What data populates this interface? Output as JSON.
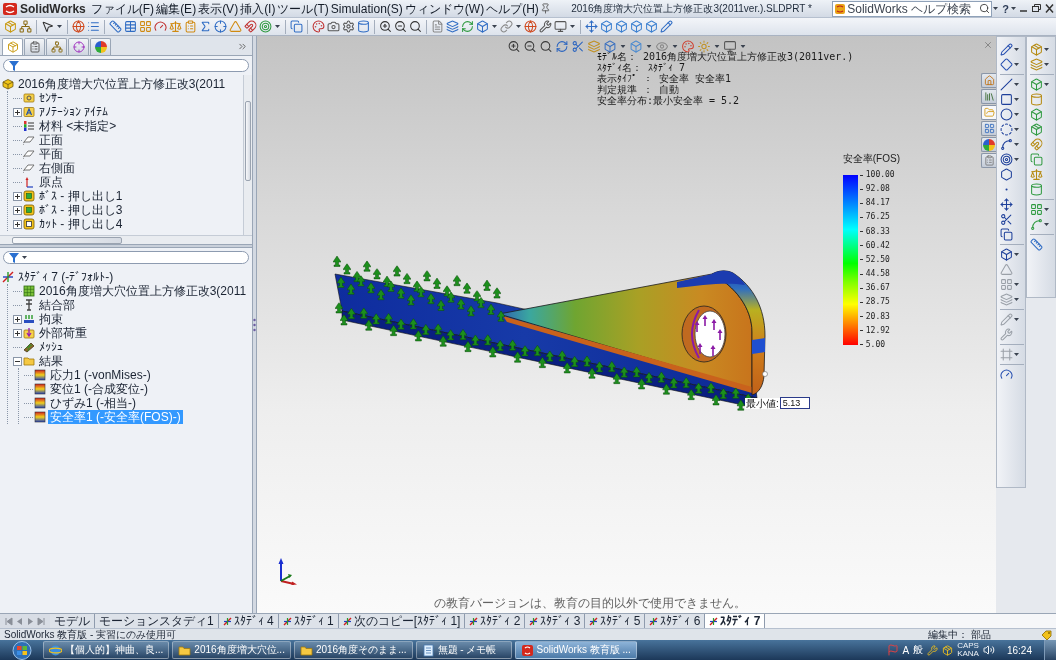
{
  "window": {
    "title": "2016角度増大穴位置上方修正改3(2011ver.).SLDPRT *"
  },
  "app": {
    "logo": "SolidWorks"
  },
  "menu": [
    "ファイル(F)",
    "編集(E)",
    "表示(V)",
    "挿入(I)",
    "ツール(T)",
    "Simulation(S)",
    "ウィンドウ(W)",
    "ヘルプ(H)"
  ],
  "search": {
    "placeholder": "SolidWorks ヘルプ検索"
  },
  "help": "?",
  "panel_tabs": [
    {
      "kind": "features",
      "selected": true
    },
    {
      "kind": "properties",
      "selected": false
    },
    {
      "kind": "configurations",
      "selected": false
    },
    {
      "kind": "dimxpert",
      "selected": false
    },
    {
      "kind": "display",
      "selected": false
    }
  ],
  "feature_tree": {
    "items": [
      {
        "label": "2016角度増大穴位置上方修正改3(2011",
        "kind": "part",
        "selected": false,
        "children": [
          {
            "label": "ｾﾝｻｰ",
            "kind": "sensor",
            "selected": false
          },
          {
            "label": "ｱﾉﾃｰｼｮﾝ ｱｲﾃﾑ",
            "kind": "annotation",
            "selected": false,
            "expanded": false
          },
          {
            "label": "材料 <未指定>",
            "kind": "material",
            "selected": false
          },
          {
            "label": "正面",
            "kind": "plane",
            "selected": false
          },
          {
            "label": "平面",
            "kind": "plane",
            "selected": false
          },
          {
            "label": "右側面",
            "kind": "plane",
            "selected": false
          },
          {
            "label": "原点",
            "kind": "origin",
            "selected": false
          },
          {
            "label": "ﾎﾞｽ - 押し出し1",
            "kind": "boss",
            "selected": false,
            "expanded": false
          },
          {
            "label": "ﾎﾞｽ - 押し出し3",
            "kind": "boss",
            "selected": false,
            "expanded": false
          },
          {
            "label": "ｶｯﾄ - 押し出し4",
            "kind": "cut",
            "selected": false,
            "expanded": false
          }
        ]
      }
    ]
  },
  "study_tree": {
    "items": [
      {
        "label": "ｽﾀﾃﾞｨ 7 (-ﾃﾞﾌｫﾙﾄ-)",
        "kind": "study",
        "selected": false,
        "children": [
          {
            "label": "2016角度増大穴位置上方修正改3(2011",
            "kind": "solid",
            "selected": false
          },
          {
            "label": "結合部",
            "kind": "connection",
            "selected": false
          },
          {
            "label": "拘束",
            "kind": "fixture",
            "selected": false,
            "expanded": false
          },
          {
            "label": "外部荷重",
            "kind": "load",
            "selected": false,
            "expanded": false
          },
          {
            "label": "ﾒｯｼｭ",
            "kind": "mesh",
            "selected": false
          },
          {
            "label": "結果",
            "kind": "folder",
            "selected": false,
            "expanded": true,
            "children": [
              {
                "label": "応力1 (-vonMises-)",
                "kind": "plot",
                "selected": false
              },
              {
                "label": "変位1 (-合成変位-)",
                "kind": "plot",
                "selected": false
              },
              {
                "label": "ひずみ1 (-相当-)",
                "kind": "plot",
                "selected": false
              },
              {
                "label": "安全率1 (-安全率(FOS)-)",
                "kind": "plot",
                "selected": true
              }
            ]
          }
        ]
      }
    ]
  },
  "viewport": {
    "info_lines": [
      "ﾓﾃﾞﾙ名： 2016角度増大穴位置上方修正改3(2011ver.)",
      "ｽﾀﾃﾞｨ名： ｽﾀﾃﾞｨ 7",
      "表示ﾀｲﾌﾟ ： 安全率 安全率1",
      "判定規準 ： 自動",
      "安全率分布:最小安全率 = 5.2"
    ],
    "legend": {
      "title": "安全率(FOS)",
      "labels": [
        "100.00",
        "92.08",
        "84.17",
        "76.25",
        "68.33",
        "60.42",
        "52.50",
        "44.58",
        "36.67",
        "28.75",
        "20.83",
        "12.92",
        "5.00"
      ]
    },
    "probe": {
      "label": "最小値:",
      "value": "5.13"
    },
    "notice": "の教育バージョンは、教育の目的以外で使用できません。"
  },
  "task_pane_tabs": [
    {
      "kind": "home",
      "selected": false
    },
    {
      "kind": "library",
      "selected": false
    },
    {
      "kind": "files",
      "selected": true
    },
    {
      "kind": "views",
      "selected": false
    },
    {
      "kind": "appearances",
      "selected": false
    },
    {
      "kind": "properties",
      "selected": false
    }
  ],
  "bottom_tabs": [
    {
      "label": "モデル",
      "kind": "model",
      "selected": false
    },
    {
      "label": "モーションスタディ1",
      "kind": "motion",
      "selected": false
    },
    {
      "label": "ｽﾀﾃﾞｨ 4",
      "kind": "study",
      "selected": false
    },
    {
      "label": "ｽﾀﾃﾞｨ 1",
      "kind": "study",
      "selected": false
    },
    {
      "label": "次のコピー[ｽﾀﾃﾞｨ 1]",
      "kind": "study",
      "selected": false
    },
    {
      "label": "ｽﾀﾃﾞｨ 2",
      "kind": "study",
      "selected": false
    },
    {
      "label": "ｽﾀﾃﾞｨ 3",
      "kind": "study",
      "selected": false
    },
    {
      "label": "ｽﾀﾃﾞｨ 5",
      "kind": "study",
      "selected": false
    },
    {
      "label": "ｽﾀﾃﾞｨ 6",
      "kind": "study",
      "selected": false
    },
    {
      "label": "ｽﾀﾃﾞｨ 7",
      "kind": "study",
      "selected": true
    }
  ],
  "status_bar": {
    "left": "SolidWorks 教育版 - 実習にのみ使用可",
    "right": "編集中： 部品"
  },
  "taskbar": {
    "items": [
      {
        "label": "【個人的】神曲、良...",
        "kind": "browser",
        "selected": false
      },
      {
        "label": "2016角度増大穴位...",
        "kind": "folder",
        "selected": false
      },
      {
        "label": "2016角度そのまま...",
        "kind": "folder",
        "selected": false
      },
      {
        "label": "無題 - メモ帳",
        "kind": "notepad",
        "selected": false
      },
      {
        "label": "SolidWorks 教育版 ...",
        "kind": "solidworks",
        "selected": true
      }
    ],
    "ime": [
      "A",
      "般"
    ],
    "indicators": [
      "CAPS",
      "KANA"
    ],
    "clock": "16:24"
  }
}
